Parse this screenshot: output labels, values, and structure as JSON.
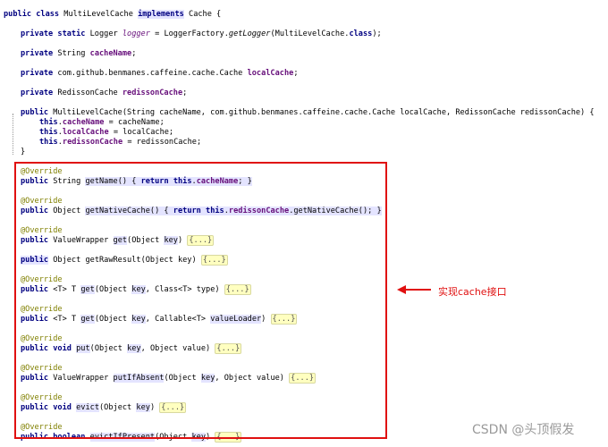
{
  "code": {
    "class_kw": "public class",
    "class_name": "MultiLevelCache",
    "implements_kw": "implements",
    "iface": "Cache {",
    "l_logger_kw": "private static",
    "l_logger_mid": "Logger",
    "l_logger_var": "logger",
    "l_logger_rest": "= LoggerFactory.",
    "l_logger_call": "getLogger",
    "l_logger_end": "(MultiLevelCache.",
    "l_logger_class": "class",
    "l_logger_close": ");",
    "l_name_kw": "private",
    "l_name_type": "String",
    "l_name_var": "cacheName",
    "l_local_kw": "private",
    "l_local_type": "com.github.benmanes.caffeine.cache.Cache",
    "l_local_var": "localCache",
    "l_redis_kw": "private",
    "l_redis_type": "RedissonCache",
    "l_redis_var": "redissonCache",
    "ctor_kw": "public",
    "ctor_sig": "MultiLevelCache(String cacheName, com.github.benmanes.caffeine.cache.Cache localCache, RedissonCache redissonCache) {",
    "this_kw": "this",
    "assign1_field": "cacheName",
    "assign1_rest": "= cacheName;",
    "assign2_field": "localCache",
    "assign2_rest": "= localCache;",
    "assign3_field": "redissonCache",
    "assign3_rest": "= redissonCache;",
    "close_brace": "}",
    "override": "@Override",
    "public_kw": "public",
    "return_kw": "return",
    "void_kw": "void",
    "boolean_kw": "boolean",
    "m1_type": "String",
    "m1_name": "getName",
    "m1_body_a": "() {",
    "m1_field": "cacheName",
    "m1_end": "; }",
    "m2_type": "Object",
    "m2_name": "getNativeCache",
    "m2_field": "redissonCache",
    "m2_end": ".getNativeCache(); }",
    "m3_type": "ValueWrapper",
    "m3_name": "get",
    "m3_params": "(Object",
    "key": "key",
    "fold": "{...}",
    "m4_type": "Object",
    "m4_name": "getRawResult",
    "m4_params": "(Object key)",
    "generic": "<T>",
    "t_type": "T",
    "m5_params_mid": ", Class<T> type)",
    "m6_params_mid": ", Callable<T>",
    "value_loader": "valueLoader",
    "m7_name": "put",
    "m7_params_mid": ", Object value)",
    "m8_type": "ValueWrapper",
    "m8_name": "putIfAbsent",
    "m9_name": "evict",
    "m10_name": "evictIfPresent"
  },
  "callout": "实现cache接口",
  "watermark": "CSDN @头顶假发",
  "colors": {
    "highlight_box": "#e01010",
    "keyword": "#000080",
    "field": "#660e7a",
    "annotation": "#808000"
  }
}
